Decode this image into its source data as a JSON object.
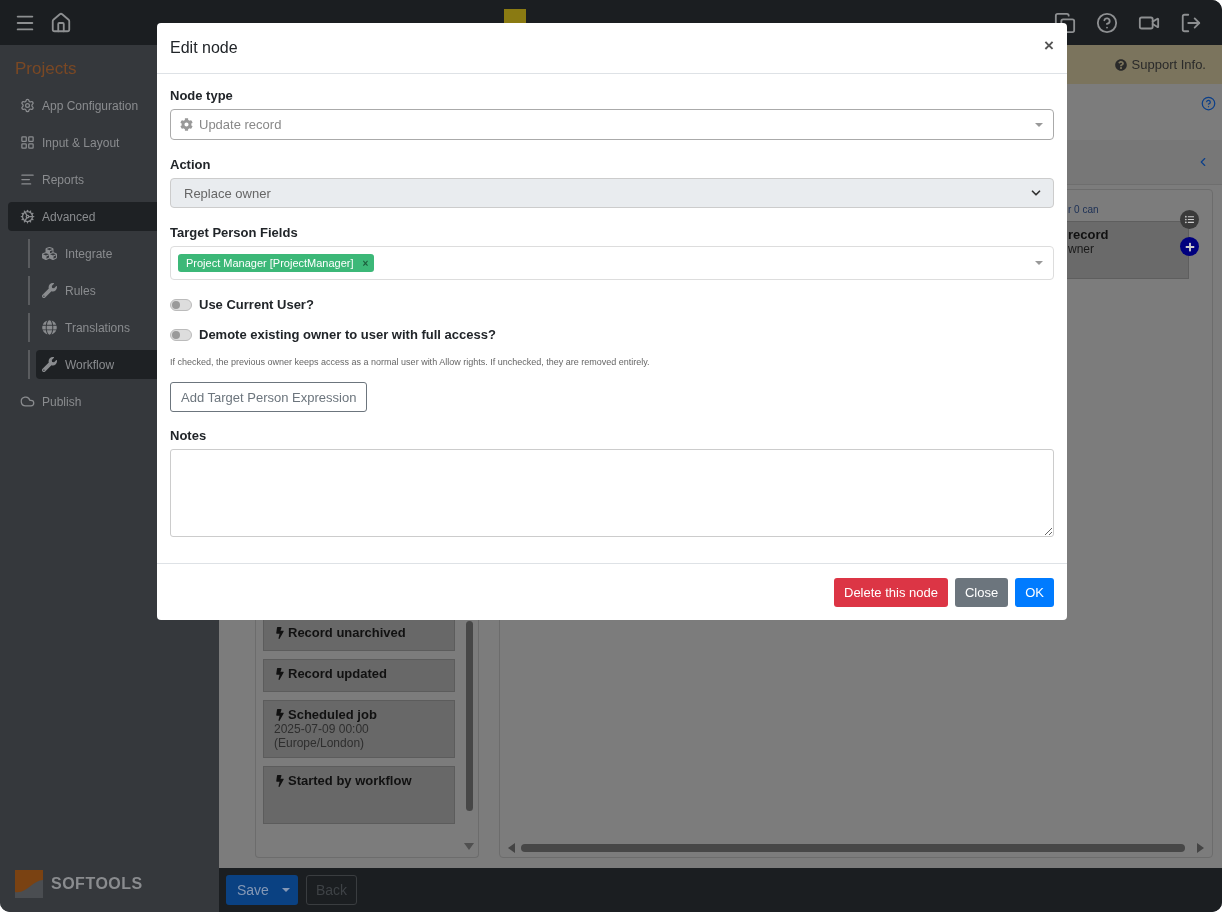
{
  "sidebar": {
    "title": "Projects",
    "items": [
      {
        "label": "App Configuration",
        "selected": false
      },
      {
        "label": "Input & Layout",
        "selected": false
      },
      {
        "label": "Reports",
        "selected": false
      },
      {
        "label": "Advanced",
        "selected": true,
        "children": [
          {
            "label": "Integrate",
            "selected": false
          },
          {
            "label": "Rules",
            "selected": false
          },
          {
            "label": "Translations",
            "selected": false
          },
          {
            "label": "Workflow",
            "selected": true
          }
        ]
      },
      {
        "label": "Publish",
        "selected": false
      }
    ],
    "brand": "SOFTOOLS"
  },
  "support_link": "Support Info.",
  "triggers": [
    {
      "title": "Record unarchived"
    },
    {
      "title": "Record updated"
    },
    {
      "title": "Scheduled job",
      "detail": [
        "2025-07-09 00:00",
        "(Europe/London)"
      ]
    },
    {
      "title": "Started by workflow"
    }
  ],
  "canvas": {
    "caption": "r 0 can",
    "node": {
      "title": "record",
      "subtitle": "wner"
    }
  },
  "bottom_bar": {
    "save": "Save",
    "back": {
      "label": "Back",
      "disabled": true
    }
  },
  "modal": {
    "title": "Edit node",
    "close": "×",
    "node_type": {
      "label": "Node type",
      "value": "Update record"
    },
    "action": {
      "label": "Action",
      "value": "Replace owner",
      "disabled": true
    },
    "target_fields": {
      "label": "Target Person Fields",
      "tags": [
        {
          "label": "Project Manager [ProjectManager]",
          "remove": "×"
        }
      ]
    },
    "toggles": [
      {
        "label": "Use Current User?",
        "on": false
      },
      {
        "label": "Demote existing owner to user with full access?",
        "on": false
      }
    ],
    "help_text": "If checked, the previous owner keeps access as a normal user with Allow rights. If unchecked, they are removed entirely.",
    "add_button": "Add Target Person Expression",
    "notes": {
      "label": "Notes"
    },
    "buttons": [
      {
        "label": "Delete this node",
        "kind": "danger"
      },
      {
        "label": "Close",
        "kind": "secondary"
      },
      {
        "label": "OK",
        "kind": "primary"
      }
    ]
  }
}
